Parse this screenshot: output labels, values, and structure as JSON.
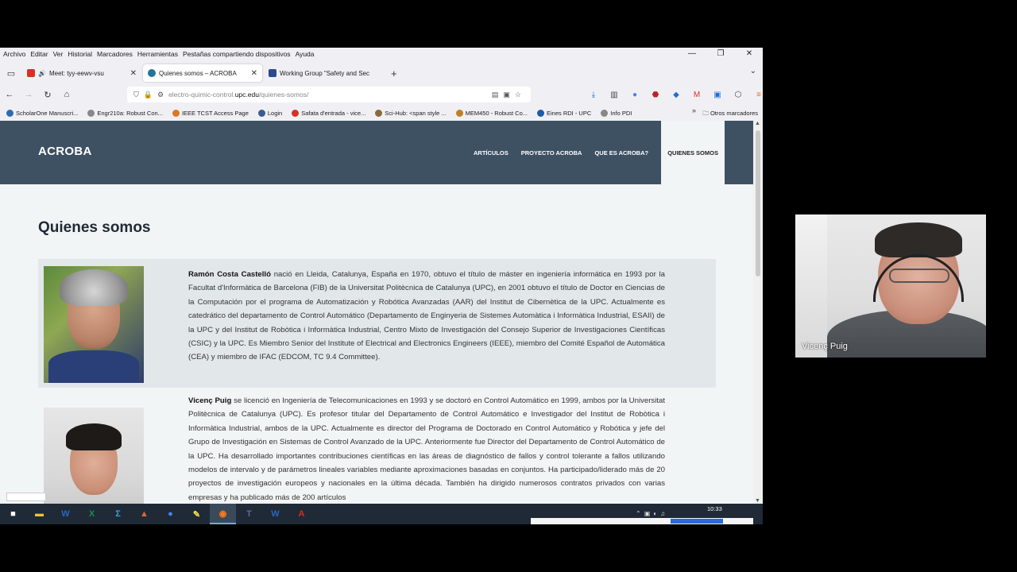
{
  "menu": [
    "Archivo",
    "Editar",
    "Ver",
    "Historial",
    "Marcadores",
    "Herramientas",
    "Pestañas compartiendo dispositivos",
    "Ayuda"
  ],
  "window_controls": {
    "minimize": "—",
    "restore": "❐",
    "close": "✕"
  },
  "tabs": [
    {
      "title": "Meet: tyy-eewv-vsu",
      "fav_color": "#d93025",
      "active": false
    },
    {
      "title": "Quienes somos – ACROBA",
      "fav_color": "#21759b",
      "active": true
    },
    {
      "title": "Working Group \"Safety and Sec",
      "fav_color": "#2b4a8a",
      "active": false
    }
  ],
  "url": {
    "prefix": "electro-quimic-control.",
    "domain": "upc.edu",
    "path": "/quienes-somos/"
  },
  "bookmarks": [
    {
      "label": "ScholarOne Manuscri...",
      "color": "#2d6cb5"
    },
    {
      "label": "Engr210a: Robust Con...",
      "color": "#888888"
    },
    {
      "label": "IEEE TCST Access Page",
      "color": "#e0761f"
    },
    {
      "label": "Login",
      "color": "#3b5c8c"
    },
    {
      "label": "Safata d'entrada - vice...",
      "color": "#d93025"
    },
    {
      "label": "Sci-Hub: <span style ...",
      "color": "#8a6a3a"
    },
    {
      "label": "MEM450 - Robust Co...",
      "color": "#c08020"
    },
    {
      "label": "Eines RDI - UPC",
      "color": "#1a5ea8"
    },
    {
      "label": "Info PDI",
      "color": "#888888"
    }
  ],
  "bookmarks_other": "Otros marcadores",
  "site": {
    "logo": "ACROBA",
    "nav": [
      "ARTÍCULOS",
      "PROYECTO ACROBA",
      "QUE ES ACROBA?",
      "QUIENES SOMOS"
    ],
    "page_title": "Quienes somos"
  },
  "members": [
    {
      "name": "Ramón Costa Castelló",
      "bio": " nació en Lleida, Catalunya, España en 1970, obtuvo el título de máster en ingeniería informática en 1993 por la Facultat d'Informàtica de Barcelona (FIB) de la Universitat Politècnica de Catalunya (UPC), en 2001 obtuvo el título de Doctor en Ciencias de la Computación por el programa de Automatización y Robótica Avanzadas (AAR) del Institut de Cibernètica de la UPC. Actualmente es catedrático del departamento de Control Automático (Departamento de Enginyeria de Sistemes Automàtica i Informàtica Industrial, ESAII) de la UPC y del Institut de Robòtica i Informàtica Industrial, Centro Mixto de Investigación del Consejo Superior de Investigaciones Científicas (CSIC) y la UPC. Es Miembro Senior del Institute of Electrical and Electronics Engineers (IEEE), miembro del Comité Español de Automática (CEA) y miembro de IFAC (EDCOM, TC 9.4 Committee)."
    },
    {
      "name": "Vicenç Puig",
      "bio": " se licenció en Ingeniería de Telecomunicaciones en 1993 y se doctoró en Control Automático en 1999, ambos por la Universitat Politècnica de Catalunya (UPC). Es profesor titular del Departamento de Control Automático e Investigador del Institut de Robòtica i Informàtica Industrial, ambos de la UPC. Actualmente es director del Programa de Doctorado en Control Automático y Robótica y jefe del Grupo de Investigación en Sistemas de Control Avanzado de la UPC. Anteriormente fue Director del Departamento de Control Automático de la UPC. Ha desarrollado importantes contribuciones científicas en las áreas de diagnóstico de fallos y control tolerante a fallos utilizando modelos de intervalo y de parámetros lineales variables mediante aproximaciones basadas en conjuntos. Ha participado/liderado más de 20 proyectos de investigación europeos y nacionales en la última década. También ha dirigido numerosos contratos privados con varias empresas y ha publicado más de 200 artículos"
    }
  ],
  "taskbar": {
    "icons": [
      {
        "name": "windows-start-icon",
        "glyph": "■",
        "color": "#ffffff"
      },
      {
        "name": "file-explorer-icon",
        "glyph": "▬",
        "color": "#f0c040"
      },
      {
        "name": "word-icon",
        "glyph": "W",
        "color": "#2b66c4"
      },
      {
        "name": "excel-icon",
        "glyph": "X",
        "color": "#1f8a4c"
      },
      {
        "name": "sigma-app-icon",
        "glyph": "Σ",
        "color": "#3aa0e0"
      },
      {
        "name": "matlab-icon",
        "glyph": "▲",
        "color": "#e06a2a"
      },
      {
        "name": "chrome-icon",
        "glyph": "●",
        "color": "#4285f4"
      },
      {
        "name": "notes-icon",
        "glyph": "✎",
        "color": "#f4e04d"
      },
      {
        "name": "firefox-icon",
        "glyph": "◉",
        "color": "#ff7a1a"
      },
      {
        "name": "teams-icon",
        "glyph": "T",
        "color": "#6264a7"
      },
      {
        "name": "word-icon-2",
        "glyph": "W",
        "color": "#2b66c4"
      },
      {
        "name": "acrobat-icon",
        "glyph": "A",
        "color": "#e0281e"
      }
    ],
    "clock": "10:33"
  },
  "video": {
    "participant_name": "Vicenç Puig"
  }
}
